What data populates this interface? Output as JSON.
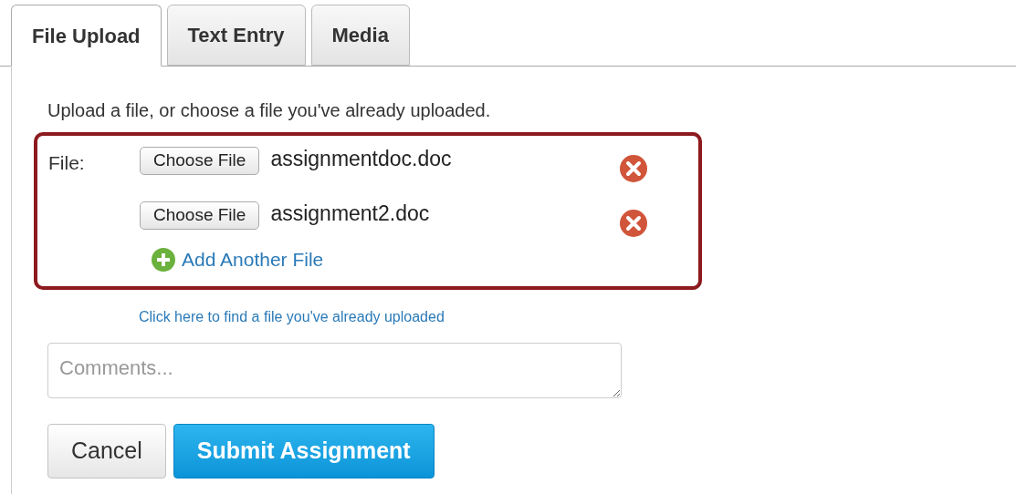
{
  "tabs": [
    {
      "label": "File Upload",
      "selected": true
    },
    {
      "label": "Text Entry",
      "selected": false
    },
    {
      "label": "Media",
      "selected": false
    }
  ],
  "instructions": "Upload a file, or choose a file you've already uploaded.",
  "file_label": "File:",
  "files": [
    {
      "button": "Choose File",
      "name": "assignmentdoc.doc"
    },
    {
      "button": "Choose File",
      "name": "assignment2.doc"
    }
  ],
  "add_file": "Add Another File",
  "find_link": "Click here to find a file you've already uploaded",
  "comments": {
    "placeholder": "Comments..."
  },
  "buttons": [
    {
      "kind": "secondary",
      "label": "Cancel"
    },
    {
      "kind": "primary",
      "label": "Submit Assignment"
    }
  ]
}
